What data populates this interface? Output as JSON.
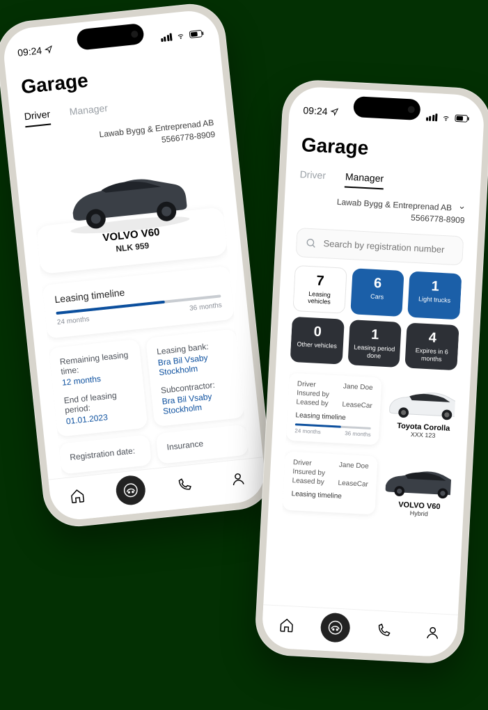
{
  "statusbar": {
    "time": "09:24"
  },
  "page_title": "Garage",
  "company": {
    "name": "Lawab Bygg & Entreprenad AB",
    "orgnr": "5566778-8909"
  },
  "tabs": {
    "driver": "Driver",
    "manager": "Manager"
  },
  "driver": {
    "vehicle": {
      "model": "VOLVO V60",
      "plate": "NLK 959"
    },
    "timeline": {
      "title": "Leasing timeline",
      "start_label": "24 months",
      "end_label": "36 months"
    },
    "info": {
      "remaining_label": "Remaining leasing time:",
      "remaining_value": "12 months",
      "end_label": "End of leasing period:",
      "end_value": "01.01.2023",
      "registration_label": "Registration date:",
      "bank_label": "Leasing bank:",
      "bank_value": "Bra Bil Vsaby Stockholm",
      "sub_label": "Subcontractor:",
      "sub_value": "Bra Bil Vsaby Stockholm",
      "insurance_label": "Insurance"
    }
  },
  "manager": {
    "search_placeholder": "Search by registration number",
    "stats": [
      {
        "value": "7",
        "label": "Leasing vehicles",
        "style": "white"
      },
      {
        "value": "6",
        "label": "Cars",
        "style": "blue"
      },
      {
        "value": "1",
        "label": "Light trucks",
        "style": "blue"
      },
      {
        "value": "0",
        "label": "Other vehicles",
        "style": "dark"
      },
      {
        "value": "1",
        "label": "Leasing period done",
        "style": "dark"
      },
      {
        "value": "4",
        "label": "Expires in 6 months",
        "style": "dark"
      }
    ],
    "vehicles": [
      {
        "driver_label": "Driver",
        "driver": "Jane Doe",
        "insured_label": "Insured by",
        "insured": "",
        "leased_label": "Leased by",
        "leased": "LeaseCar",
        "timeline_title": "Leasing timeline",
        "start_label": "24 months",
        "end_label": "36 months",
        "model": "Toyota Corolla",
        "plate": "XXX 123"
      },
      {
        "driver_label": "Driver",
        "driver": "Jane Doe",
        "insured_label": "Insured by",
        "insured": "",
        "leased_label": "Leased by",
        "leased": "LeaseCar",
        "timeline_title": "Leasing timeline",
        "model": "VOLVO V60",
        "plate": "Hybrid"
      }
    ]
  }
}
